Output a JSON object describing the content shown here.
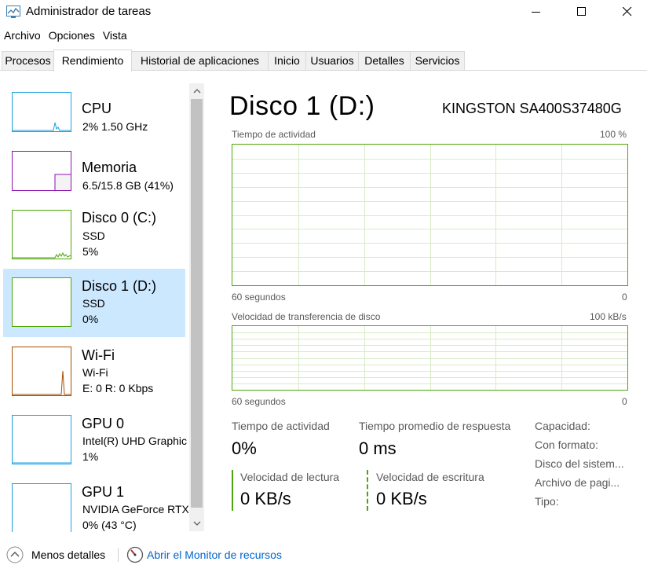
{
  "window": {
    "title": "Administrador de tareas"
  },
  "menu": [
    "Archivo",
    "Opciones",
    "Vista"
  ],
  "tabs": [
    "Procesos",
    "Rendimiento",
    "Historial de aplicaciones",
    "Inicio",
    "Usuarios",
    "Detalles",
    "Servicios"
  ],
  "active_tab": "Rendimiento",
  "sidebar": {
    "items": [
      {
        "name": "CPU",
        "line1": "2%  1.50 GHz",
        "line2": "",
        "color": "#1ba1e2"
      },
      {
        "name": "Memoria",
        "line1": "6.5/15.8 GB (41%)",
        "line2": "",
        "color": "#8b12ae"
      },
      {
        "name": "Disco 0 (C:)",
        "line1": "SSD",
        "line2": "5%",
        "color": "#4da60c"
      },
      {
        "name": "Disco 1 (D:)",
        "line1": "SSD",
        "line2": "0%",
        "color": "#4da60c"
      },
      {
        "name": "Wi-Fi",
        "line1": "Wi-Fi",
        "line2": "E: 0 R: 0 Kbps",
        "color": "#a74f01"
      },
      {
        "name": "GPU 0",
        "line1": "Intel(R) UHD Graphic",
        "line2": "1%",
        "color": "#1ba1e2"
      },
      {
        "name": "GPU 1",
        "line1": "NVIDIA GeForce RTX",
        "line2": "0% (43 °C)",
        "color": "#1ba1e2"
      }
    ],
    "selected": "Disco 1 (D:)"
  },
  "main": {
    "title": "Disco 1 (D:)",
    "device": "KINGSTON SA400S37480G",
    "graph1": {
      "label": "Tiempo de actividad",
      "max": "100 %",
      "time": "60 segundos",
      "min": "0"
    },
    "graph2": {
      "label": "Velocidad de transferencia de disco",
      "max": "100 kB/s",
      "time": "60 segundos",
      "min": "0"
    },
    "stats": {
      "active_label": "Tiempo de actividad",
      "active_value": "0%",
      "response_label": "Tiempo promedio de respuesta",
      "response_value": "0 ms",
      "read_label": "Velocidad de lectura",
      "read_value": "0 KB/s",
      "write_label": "Velocidad de escritura",
      "write_value": "0 KB/s"
    },
    "properties": [
      "Capacidad:",
      "Con formato:",
      "Disco del sistem...",
      "Archivo de pagi...",
      "Tipo:"
    ]
  },
  "footer": {
    "less_details": "Menos detalles",
    "resource_monitor": "Abrir el Monitor de recursos"
  },
  "colors": {
    "disk_green": "#4da60c",
    "selected_bg": "#cce8ff",
    "link": "#0066cc"
  }
}
